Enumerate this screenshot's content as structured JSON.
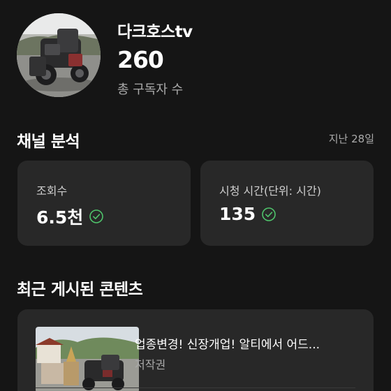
{
  "channel": {
    "name": "다크호스tv",
    "subscriber_count": "260",
    "subscriber_label": "총 구독자 수"
  },
  "analytics": {
    "title": "채널 분석",
    "period": "지난 28일",
    "cards": [
      {
        "label": "조회수",
        "value": "6.5천",
        "icon": "check-circle-icon"
      },
      {
        "label": "시청 시간(단위: 시간)",
        "value": "135",
        "icon": "check-circle-icon"
      }
    ]
  },
  "recent": {
    "title": "최근 게시된 콘텐츠",
    "items": [
      {
        "title": "업종변경! 신장개업! 알티에서 어드...",
        "meta": "저작권"
      }
    ]
  },
  "colors": {
    "background": "#151515",
    "card": "#282828",
    "secondary_text": "#aaaaaa",
    "check": "#4fc36b"
  }
}
